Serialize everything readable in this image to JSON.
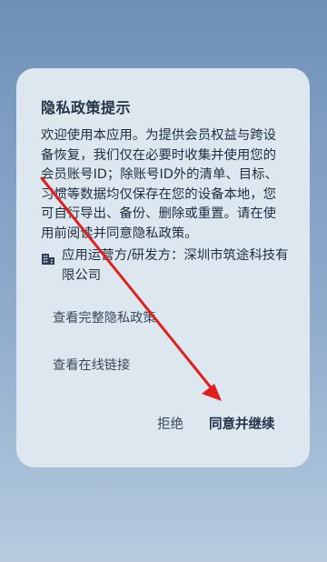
{
  "dialog": {
    "title": "隐私政策提示",
    "body": "欢迎使用本应用。为提供会员权益与跨设备恢复，我们仅在必要时收集并使用您的会员账号ID；除账号ID外的清单、目标、习惯等数据均仅保存在您的设备本地，您可自行导出、备份、删除或重置。请在使用前阅读并同意隐私政策。",
    "developer": "应用运营方/研发方：深圳市筑途科技有限公司",
    "developer_icon": "building-icon",
    "link_policy": "查看完整隐私政策",
    "link_online": "查看在线链接",
    "reject_label": "拒绝",
    "agree_label": "同意并继续"
  },
  "colors": {
    "background": "#7f9ec2",
    "dialog": "#dde7f0",
    "annotation_arrow": "#e0201c"
  }
}
